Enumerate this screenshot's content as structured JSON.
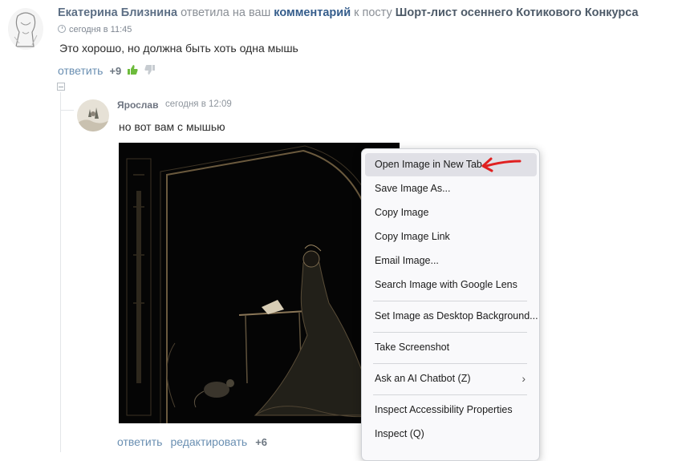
{
  "notification": {
    "author": "Екатерина Близнина",
    "action": "ответила на ваш",
    "target": "комментарий",
    "preposition": "к посту",
    "post_title": "Шорт-лист осеннего Котикового Конкурса",
    "time": "сегодня в 11:45",
    "text": "Это хорошо, но должна быть хоть одна мышь",
    "reply_label": "ответить",
    "score": "+9"
  },
  "reply": {
    "author": "Ярослав",
    "time": "сегодня в 12:09",
    "text": "но вот вам с мышью",
    "reply_label": "ответить",
    "edit_label": "редактировать",
    "score": "+6"
  },
  "context_menu": {
    "items": [
      {
        "label": "Open Image in New Tab"
      },
      {
        "label": "Save Image As..."
      },
      {
        "label": "Copy Image"
      },
      {
        "label": "Copy Image Link"
      },
      {
        "label": "Email Image..."
      },
      {
        "label": "Search Image with Google Lens"
      },
      {
        "label": "Set Image as Desktop Background..."
      },
      {
        "label": "Take Screenshot"
      },
      {
        "label": "Ask an AI Chatbot (Z)"
      },
      {
        "label": "Inspect Accessibility Properties"
      },
      {
        "label": "Inspect (Q)"
      }
    ]
  },
  "colors": {
    "accent_link": "#355d8c",
    "thumb_up": "#6dbb3c",
    "arrow": "#e02020"
  }
}
